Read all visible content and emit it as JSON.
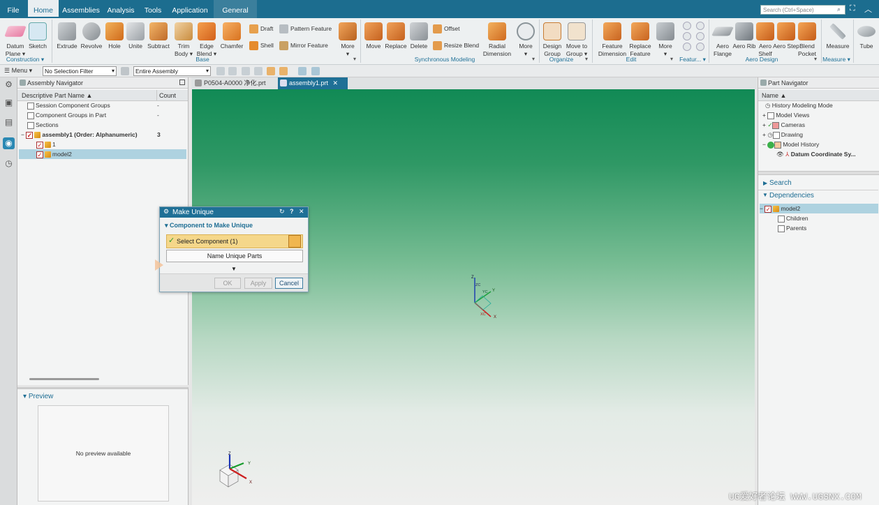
{
  "menu": {
    "file": "File",
    "home": "Home",
    "assemblies": "Assemblies",
    "analysis": "Analysis",
    "tools": "Tools",
    "application": "Application",
    "general": "General"
  },
  "search": {
    "placeholder": "Search (Ctrl+Space)"
  },
  "ribbon": {
    "datum_plane": "Datum Plane",
    "sketch": "Sketch",
    "extrude": "Extrude",
    "revolve": "Revolve",
    "hole": "Hole",
    "unite": "Unite",
    "subtract": "Subtract",
    "trim_body": "Trim Body",
    "edge_blend": "Edge Blend",
    "chamfer": "Chamfer",
    "draft": "Draft",
    "shell": "Shell",
    "pattern_feature": "Pattern Feature",
    "mirror_feature": "Mirror Feature",
    "more": "More",
    "move": "Move",
    "replace": "Replace",
    "delete": "Delete",
    "offset": "Offset",
    "resize_blend": "Resize Blend",
    "radial_dimension": "Radial Dimension",
    "design_group": "Design Group",
    "move_to_group": "Move to Group",
    "feature_dimension": "Feature Dimension",
    "replace_feature": "Replace Feature",
    "aero_flange": "Aero Flange",
    "aero_rib": "Aero Rib",
    "aero_shelf": "Aero Shelf",
    "aero_step": "Aero Step",
    "blend_pocket": "Blend Pocket",
    "measure": "Measure",
    "tube": "Tube",
    "groups": {
      "construction": "Construction",
      "base": "Base",
      "synchronous": "Synchronous Modeling",
      "organize": "Organize",
      "edit": "Edit",
      "featur": "Featur...",
      "aero_design": "Aero Design",
      "measure": "Measure"
    }
  },
  "toolbar": {
    "menu": "Menu",
    "selection_filter": "No Selection Filter",
    "scope": "Entire Assembly"
  },
  "assembly_nav": {
    "title": "Assembly Navigator",
    "col_name": "Descriptive Part Name",
    "col_count": "Count",
    "rows": [
      {
        "label": "Session Component Groups",
        "count": "-"
      },
      {
        "label": "Component Groups in Part",
        "count": "-"
      },
      {
        "label": "Sections",
        "count": ""
      },
      {
        "label": "assembly1 (Order: Alphanumeric)",
        "count": "3"
      },
      {
        "label": "1",
        "count": ""
      },
      {
        "label": "model2",
        "count": ""
      }
    ]
  },
  "preview": {
    "title": "Preview",
    "empty": "No preview available"
  },
  "file_tabs": [
    {
      "label": "P0504-A0000 净化.prt"
    },
    {
      "label": "assembly1.prt"
    }
  ],
  "dialog": {
    "title": "Make Unique",
    "section": "Component to Make Unique",
    "select": "Select Component (1)",
    "name_unique": "Name Unique Parts",
    "ok": "OK",
    "apply": "Apply",
    "cancel": "Cancel"
  },
  "part_nav": {
    "title": "Part Navigator",
    "col_name": "Name",
    "rows": [
      {
        "label": "History Modeling Mode"
      },
      {
        "label": "Model Views"
      },
      {
        "label": "Cameras"
      },
      {
        "label": "Drawing"
      },
      {
        "label": "Model History"
      },
      {
        "label": "Datum Coordinate Sy..."
      }
    ],
    "search": "Search",
    "dependencies": "Dependencies",
    "dep_rows": [
      {
        "label": "model2"
      },
      {
        "label": "Children"
      },
      {
        "label": "Parents"
      }
    ]
  },
  "axes": {
    "z": "Z",
    "y": "Y",
    "x": "X",
    "zc": "ZC",
    "yc": "YC",
    "xc": "XC"
  },
  "watermark": "UG爱好者论坛 WWW.UGSNX.COM"
}
